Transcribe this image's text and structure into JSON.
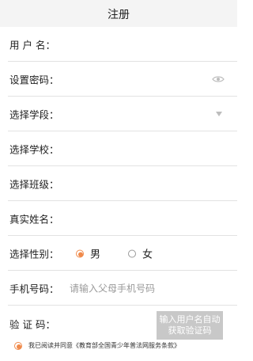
{
  "header": {
    "title": "注册"
  },
  "form": {
    "username": {
      "label": "用 户 名："
    },
    "password": {
      "label": "设置密码：",
      "icon": "eye-icon"
    },
    "stage": {
      "label": "选择学段：",
      "icon": "dropdown-icon"
    },
    "school": {
      "label": "选择学校："
    },
    "class": {
      "label": "选择班级："
    },
    "realname": {
      "label": "真实姓名："
    },
    "gender": {
      "label": "选择性别：",
      "options": [
        "男",
        "女"
      ],
      "selected": "男"
    },
    "phone": {
      "label": "手机号码：",
      "placeholder": "请输入父母手机号码"
    },
    "code": {
      "label": "验 证 码：",
      "button_line1": "输入用户名自动",
      "button_line2": "获取验证码"
    }
  },
  "agreement": {
    "text": "我已阅读并同意《教育部全国青少年普法网服务条款》",
    "checked": true
  },
  "colors": {
    "accent": "#f08a4b",
    "button_bg": "#c8c8c8"
  }
}
